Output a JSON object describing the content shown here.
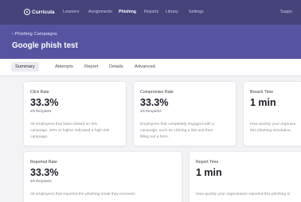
{
  "nav": {
    "logo": "Curricula",
    "items": [
      "Learners",
      "Assignments",
      "Phishing",
      "Reports",
      "Library",
      "Settings"
    ],
    "active": "Phishing",
    "right_label": "Suppo"
  },
  "header": {
    "back_label": "Phishing Campaigns",
    "title": "Google phish test"
  },
  "tabs": {
    "items": [
      "Summary",
      "Attempts",
      "Report",
      "Details",
      "Advanced"
    ],
    "active": "Summary"
  },
  "metrics": {
    "click_rate": {
      "label": "Click Rate",
      "value": "33.3%",
      "sub": "2/6 Recipients",
      "desc_lines": [
        "All employees that have clicked on this",
        "campaign. 20% or higher indicated a high-risk",
        "campaign."
      ]
    },
    "compromise_rate": {
      "label": "Compromise Rate",
      "value": "33.3%",
      "sub": "2/6 Recipients",
      "desc_lines": [
        "Employees that completely engaged with a",
        "campaign, such as clicking a link and then",
        "filling out a form."
      ]
    },
    "breach_time": {
      "label": "Breach Time",
      "value": "1 min",
      "desc_lines": [
        "How quickly your organiza",
        "this phishing simulation."
      ]
    },
    "reported_rate": {
      "label": "Reported Rate",
      "value": "33.3%",
      "sub": "2/6 Recipients",
      "desc_lines": [
        "All employees that reported the phishing email they received."
      ]
    },
    "report_time": {
      "label": "Report Time",
      "value": "1 min",
      "desc_lines": [
        "How quickly your organization reported this phishing si"
      ]
    }
  }
}
